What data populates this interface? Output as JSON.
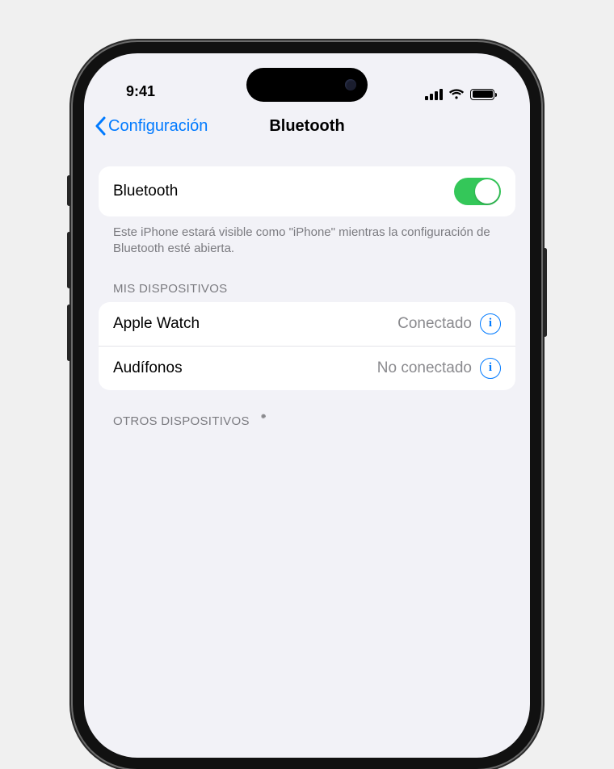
{
  "status_bar": {
    "time": "9:41"
  },
  "nav": {
    "back_label": "Configuración",
    "title": "Bluetooth"
  },
  "bluetooth_toggle": {
    "label": "Bluetooth",
    "on": true
  },
  "visibility_text": "Este iPhone estará visible como \"iPhone\" mientras la configuración de Bluetooth esté abierta.",
  "sections": {
    "my_devices": {
      "header": "MIS DISPOSITIVOS",
      "items": [
        {
          "name": "Apple Watch",
          "status": "Conectado"
        },
        {
          "name": "Audífonos",
          "status": "No conectado"
        }
      ]
    },
    "other_devices": {
      "header": "OTROS DISPOSITIVOS",
      "searching": true
    }
  },
  "colors": {
    "accent": "#007aff",
    "toggle_on": "#34c759",
    "bg": "#f2f2f7"
  }
}
